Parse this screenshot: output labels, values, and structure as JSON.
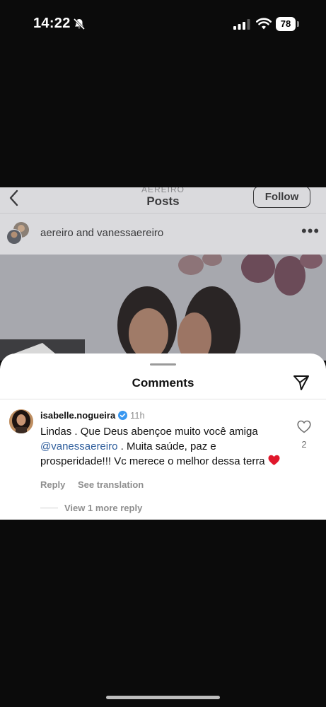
{
  "status_bar": {
    "time": "14:22",
    "battery": "78"
  },
  "post_view": {
    "username_header": "AEREIRO",
    "title": "Posts",
    "follow_label": "Follow",
    "authors": "aereiro and vanessaereiro",
    "more": "•••"
  },
  "comments_sheet": {
    "title": "Comments",
    "comment": {
      "username": "isabelle.nogueira",
      "time": "11h",
      "text_before": "Lindas . Que Deus abençoe muito você amiga ",
      "mention": "@vanessaereiro",
      "text_after": " . Muita saúde, paz e prosperidade!!! Vc merece o melhor dessa terra ",
      "likes": "2",
      "reply_label": "Reply",
      "translate_label": "See translation"
    },
    "view_more_replies": "View 1 more reply"
  },
  "colors": {
    "mention": "#2f5e9c",
    "verified": "#3897f0",
    "emoji_heart": "#e0172b"
  },
  "icons": [
    "bell-slash-icon",
    "signal-icon",
    "wifi-icon",
    "battery-icon",
    "back-arrow-icon",
    "more-icon",
    "share-icon",
    "verified-icon",
    "heart-icon"
  ]
}
